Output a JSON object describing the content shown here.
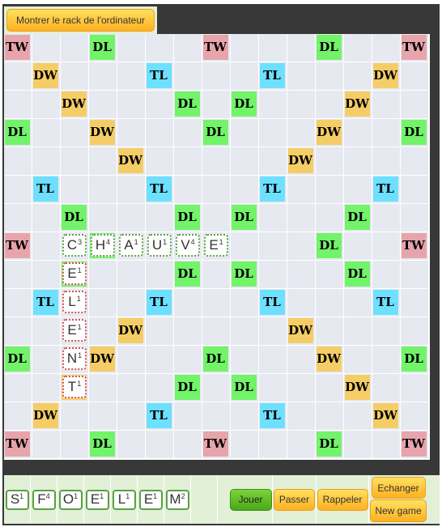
{
  "top": {
    "show_rack_label": "Montrer le rack de l'ordinateur"
  },
  "board": {
    "bonus_rows": [
      "T..d...T...d..T",
      ".D...t...t...D.",
      "..D...d.d...D..",
      "d..D...d...D..d",
      "....D.....D....",
      ".t...t...t...t.",
      "..d...d.d...d..",
      "T..d...*...d..T",
      "..d...d.d...d..",
      ".t...t...t...t.",
      "....D.....D....",
      "d..D...d...D..d",
      "..D...d.d...D..",
      ".D...t...t...D.",
      "T..d...T...d..T"
    ],
    "bonus_labels": {
      "T": "TW",
      "D": "DW",
      "t": "TL",
      "d": "DL"
    },
    "tiles": [
      {
        "row": 7,
        "col": 2,
        "letter": "C",
        "points": "3",
        "state": "fixed"
      },
      {
        "row": 7,
        "col": 3,
        "letter": "H",
        "points": "4",
        "state": "fixed"
      },
      {
        "row": 7,
        "col": 4,
        "letter": "A",
        "points": "1",
        "state": "fixed"
      },
      {
        "row": 7,
        "col": 5,
        "letter": "U",
        "points": "1",
        "state": "fixed"
      },
      {
        "row": 7,
        "col": 6,
        "letter": "V",
        "points": "4",
        "state": "fixed"
      },
      {
        "row": 7,
        "col": 7,
        "letter": "E",
        "points": "1",
        "state": "fixed"
      },
      {
        "row": 8,
        "col": 2,
        "letter": "E",
        "points": "1",
        "state": "pending"
      },
      {
        "row": 9,
        "col": 2,
        "letter": "L",
        "points": "1",
        "state": "pending"
      },
      {
        "row": 10,
        "col": 2,
        "letter": "E",
        "points": "1",
        "state": "pending"
      },
      {
        "row": 11,
        "col": 2,
        "letter": "N",
        "points": "1",
        "state": "pending"
      },
      {
        "row": 12,
        "col": 2,
        "letter": "T",
        "points": "1",
        "state": "pending"
      }
    ]
  },
  "rack": [
    {
      "letter": "S",
      "points": "1"
    },
    {
      "letter": "F",
      "points": "4"
    },
    {
      "letter": "O",
      "points": "1"
    },
    {
      "letter": "E",
      "points": "1"
    },
    {
      "letter": "L",
      "points": "1"
    },
    {
      "letter": "E",
      "points": "1"
    },
    {
      "letter": "M",
      "points": "2"
    }
  ],
  "buttons": {
    "play": "Jouer",
    "pass": "Passer",
    "recall": "Rappeler",
    "exchange": "Echanger",
    "new_game": "New game"
  },
  "colors": {
    "TW": "#e8a4ab",
    "DW": "#f5cd66",
    "TL": "#6de0ff",
    "DL": "#72f36a",
    "frame": "#383838",
    "panel": "#e2f0d8"
  }
}
